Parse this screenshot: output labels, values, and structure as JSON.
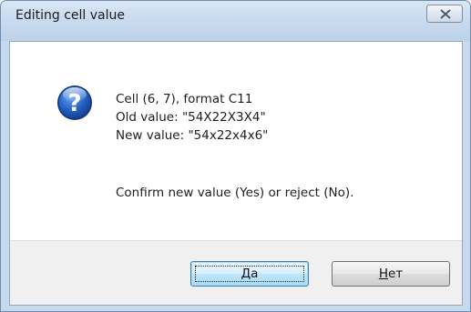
{
  "window": {
    "title": "Editing cell value",
    "close_icon": "close-icon"
  },
  "message": {
    "icon": "question-icon",
    "lines": [
      "Cell (6, 7), format C11",
      "Old value: \"54X22X3X4\"",
      "New value: \"54x22x4x6\""
    ],
    "confirm": "Confirm new value (Yes) or reject (No)."
  },
  "buttons": {
    "yes": {
      "mnemonic": "Д",
      "rest": "а"
    },
    "no": {
      "mnemonic": "Н",
      "rest": "ет"
    }
  },
  "colors": {
    "titlebar": "#c6d9ee",
    "footer": "#f0f0f0",
    "default_button": "#bee6fd",
    "icon_blue": "#1f5fbf"
  }
}
